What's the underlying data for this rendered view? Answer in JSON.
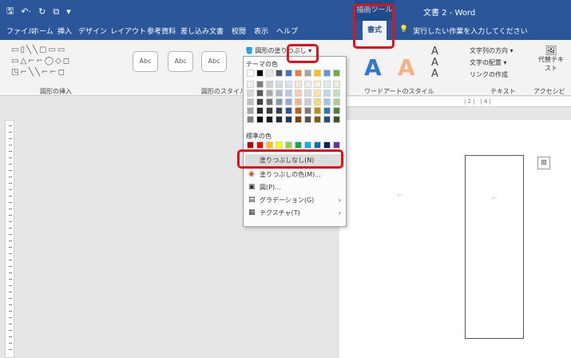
{
  "titlebar": {
    "qat": [
      "🖫",
      "↶·",
      "↻",
      "⧉",
      "▾"
    ],
    "context_tab": "描画ツール",
    "doc_title": "文書 2 - Word"
  },
  "tabs": {
    "items": [
      "ファイル",
      "ホーム",
      "挿入",
      "デザイン",
      "レイアウト",
      "参考資料",
      "差し込み文書",
      "校閲",
      "表示",
      "ヘルプ"
    ],
    "active": "書式",
    "tellme": "実行したい作業を入力してください"
  },
  "ribbon": {
    "insert_shapes_label": "図形の挿入",
    "shape_styles_label": "図形のスタイル",
    "wordart_label": "ワードアートのスタイル",
    "text_label": "テキスト",
    "accessibility_label": "アクセシビリティ",
    "style_btn": "Abc",
    "fill_btn_label": "図形の塗りつぶし",
    "text_menu": [
      "文字列の方向 ▾",
      "文字の配置 ▾",
      "リンクの作成"
    ],
    "alt_text": "代替テキスト",
    "wordart_a": "A"
  },
  "dropdown": {
    "theme_colors_heading": "テーマの色",
    "standard_colors_heading": "標準の色",
    "no_fill": "塗りつぶしなし(N)",
    "more_colors": "塗りつぶしの色(M)...",
    "picture": "図(P)...",
    "gradient": "グラデーション(G)",
    "texture": "テクスチャ(T)",
    "theme_row": [
      "#ffffff",
      "#000000",
      "#e7e6e6",
      "#44546a",
      "#4472c4",
      "#ed7d31",
      "#a5a5a5",
      "#ffc000",
      "#5b9bd5",
      "#70ad47"
    ],
    "theme_cols": [
      [
        "#f2f2f2",
        "#d9d9d9",
        "#bfbfbf",
        "#a6a6a6",
        "#808080"
      ],
      [
        "#7f7f7f",
        "#595959",
        "#404040",
        "#262626",
        "#0d0d0d"
      ],
      [
        "#d0cece",
        "#aeaaaa",
        "#757171",
        "#3a3838",
        "#171616"
      ],
      [
        "#d6dce5",
        "#adb9ca",
        "#8497b0",
        "#333f50",
        "#222a35"
      ],
      [
        "#dae3f3",
        "#b4c7e7",
        "#8faadc",
        "#2f5597",
        "#203864"
      ],
      [
        "#fbe5d6",
        "#f8cbad",
        "#f4b183",
        "#c55a11",
        "#843c0c"
      ],
      [
        "#ededed",
        "#dbdbdb",
        "#c9c9c9",
        "#7b7b7b",
        "#525252"
      ],
      [
        "#fff2cc",
        "#ffe699",
        "#ffd966",
        "#bf9000",
        "#7f6000"
      ],
      [
        "#deebf7",
        "#bdd7ee",
        "#9dc3e6",
        "#2e75b6",
        "#1f4e79"
      ],
      [
        "#e2f0d9",
        "#c5e0b4",
        "#a9d18e",
        "#548235",
        "#385723"
      ]
    ],
    "standard_row": [
      "#c00000",
      "#ff0000",
      "#ffc000",
      "#ffff00",
      "#92d050",
      "#00b050",
      "#00b0f0",
      "#0070c0",
      "#002060",
      "#7030a0"
    ]
  },
  "highlight_color": "#e0121a"
}
